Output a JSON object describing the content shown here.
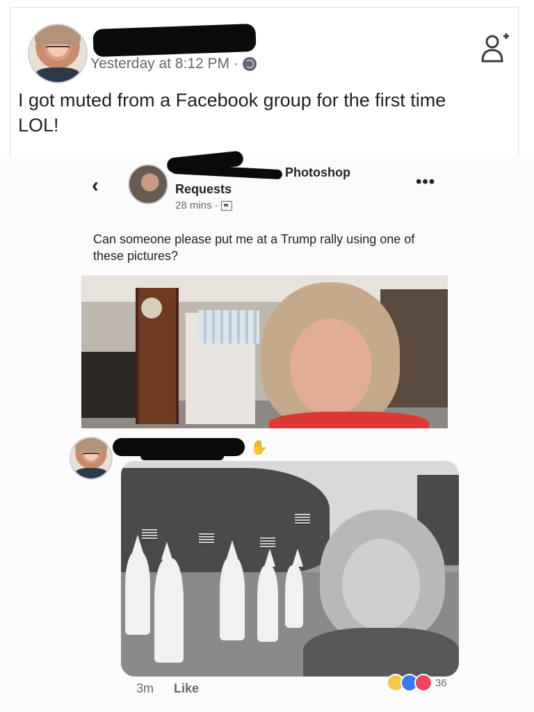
{
  "outer_post": {
    "timestamp": "Yesterday at 8:12 PM",
    "separator": "·",
    "text": "I got muted from a Facebook group for the first time LOL!"
  },
  "inner_post": {
    "group_name": "Photoshop",
    "group_subtitle": "Requests",
    "time": "28 mins",
    "separator": "·",
    "text": "Can someone please put me at a Trump rally using one of these pictures?"
  },
  "comment": {
    "time": "3m",
    "like_label": "Like",
    "reaction_count": "36"
  },
  "icons": {
    "privacy": "globe-icon",
    "add_friend": "add-friend-icon",
    "back": "chevron-left-icon",
    "more": "more-icon",
    "group": "group-icon",
    "wave": "wave-icon"
  },
  "colors": {
    "text_primary": "#1c1e21",
    "text_secondary": "#606770",
    "like_blue": "#3b7af6",
    "love_red": "#f0435f",
    "haha_yellow": "#f7c64a"
  },
  "glyphs": {
    "back": "‹",
    "more": "•••",
    "wave": "✋"
  }
}
